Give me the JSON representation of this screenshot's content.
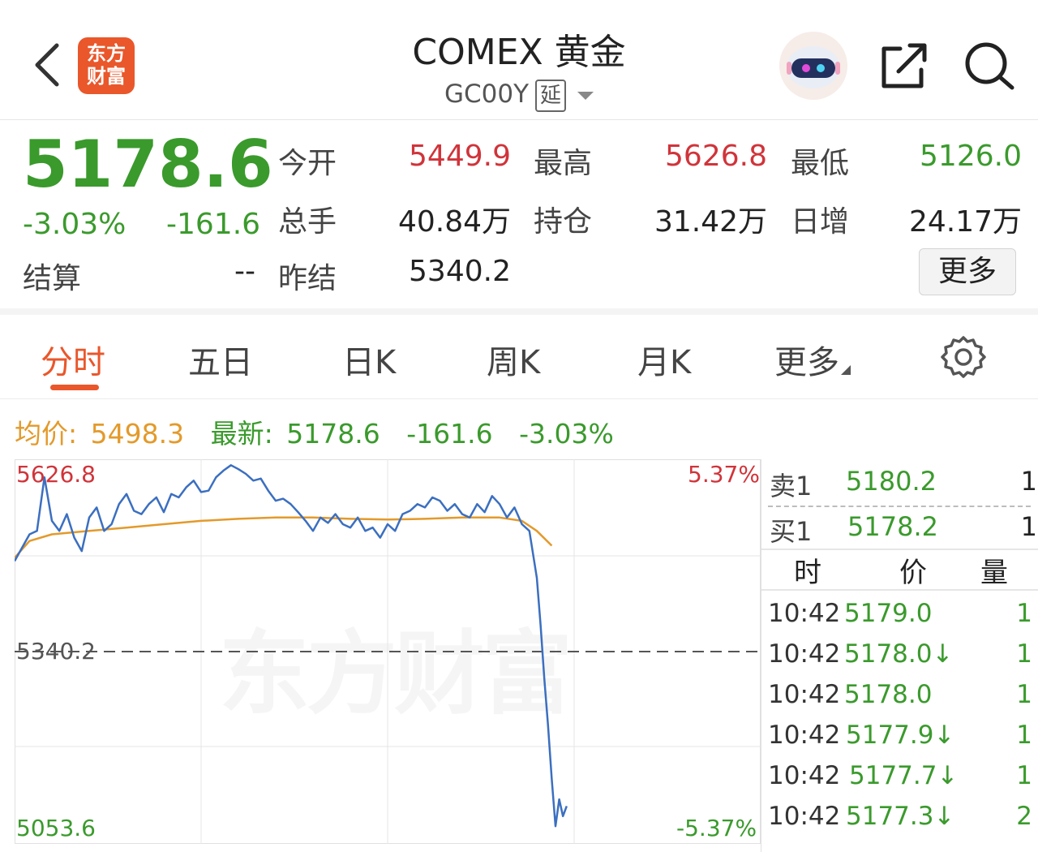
{
  "header": {
    "title": "COMEX 黄金",
    "code": "GC00Y",
    "delay_badge": "延",
    "logo_line1": "东方",
    "logo_line2": "财富"
  },
  "quote": {
    "last": "5178.6",
    "change_pct": "-3.03%",
    "change": "-161.6",
    "open_label": "今开",
    "open": "5449.9",
    "high_label": "最高",
    "high": "5626.8",
    "low_label": "最低",
    "low": "5126.0",
    "volume_label": "总手",
    "volume": "40.84万",
    "oi_label": "持仓",
    "oi": "31.42万",
    "daily_inc_label": "日增",
    "daily_inc": "24.17万",
    "settle_label": "结算",
    "settle": "--",
    "prev_settle_label": "昨结",
    "prev_settle": "5340.2",
    "more_label": "更多"
  },
  "tabs": [
    "分时",
    "五日",
    "日K",
    "周K",
    "月K",
    "更多"
  ],
  "legend": {
    "avg_label": "均价:",
    "avg": "5498.3",
    "latest_label": "最新:",
    "latest": "5178.6",
    "change": "-161.6",
    "change_pct": "-3.03%"
  },
  "chart_labels": {
    "top_price": "5626.8",
    "mid_price": "5340.2",
    "bottom_price": "5053.6",
    "top_pct": "5.37%",
    "bottom_pct": "-5.37%",
    "watermark": "东方财富"
  },
  "chart_data": {
    "type": "line",
    "x_range": [
      0,
      1
    ],
    "ylim": [
      5053.6,
      5626.8
    ],
    "reference": 5340.2,
    "series": [
      {
        "name": "price",
        "color": "#3b6fc0",
        "x": [
          0,
          0.02,
          0.03,
          0.04,
          0.05,
          0.06,
          0.07,
          0.08,
          0.09,
          0.1,
          0.11,
          0.12,
          0.13,
          0.14,
          0.15,
          0.16,
          0.17,
          0.18,
          0.19,
          0.2,
          0.21,
          0.22,
          0.23,
          0.24,
          0.25,
          0.26,
          0.27,
          0.28,
          0.29,
          0.3,
          0.31,
          0.32,
          0.33,
          0.34,
          0.35,
          0.36,
          0.37,
          0.38,
          0.39,
          0.4,
          0.41,
          0.42,
          0.43,
          0.44,
          0.45,
          0.46,
          0.47,
          0.48,
          0.49,
          0.5,
          0.51,
          0.52,
          0.53,
          0.54,
          0.55,
          0.56,
          0.57,
          0.58,
          0.59,
          0.6,
          0.61,
          0.62,
          0.63,
          0.64,
          0.65,
          0.66,
          0.67,
          0.68,
          0.69,
          0.7,
          0.705,
          0.71,
          0.715,
          0.72,
          0.725,
          0.73,
          0.735,
          0.74
        ],
        "values": [
          5475,
          5515,
          5520,
          5600,
          5535,
          5520,
          5545,
          5510,
          5490,
          5540,
          5555,
          5520,
          5530,
          5560,
          5575,
          5550,
          5545,
          5560,
          5570,
          5548,
          5575,
          5570,
          5585,
          5595,
          5578,
          5580,
          5600,
          5610,
          5618,
          5612,
          5605,
          5595,
          5598,
          5580,
          5565,
          5568,
          5560,
          5548,
          5535,
          5520,
          5540,
          5532,
          5545,
          5530,
          5525,
          5540,
          5520,
          5525,
          5510,
          5530,
          5520,
          5545,
          5550,
          5560,
          5555,
          5570,
          5565,
          5550,
          5560,
          5545,
          5540,
          5560,
          5548,
          5572,
          5560,
          5540,
          5555,
          5530,
          5520,
          5450,
          5380,
          5300,
          5230,
          5150,
          5080,
          5120,
          5095,
          5110
        ]
      },
      {
        "name": "avg",
        "color": "#e39a2b",
        "x": [
          0,
          0.02,
          0.05,
          0.1,
          0.15,
          0.2,
          0.25,
          0.3,
          0.35,
          0.4,
          0.45,
          0.5,
          0.55,
          0.6,
          0.65,
          0.68,
          0.7,
          0.72
        ],
        "values": [
          5480,
          5505,
          5515,
          5520,
          5525,
          5530,
          5535,
          5538,
          5540,
          5540,
          5538,
          5537,
          5538,
          5540,
          5540,
          5535,
          5520,
          5498
        ]
      }
    ]
  },
  "order_book": {
    "ask_label": "卖1",
    "ask": "5180.2",
    "ask_qty": "1",
    "bid_label": "买1",
    "bid": "5178.2",
    "bid_qty": "1"
  },
  "ticks": {
    "headers": [
      "时",
      "价",
      "量"
    ],
    "rows": [
      {
        "time": "10:42",
        "price": "5179.0",
        "qty": "1"
      },
      {
        "time": "10:42",
        "price": "5178.0↓",
        "qty": "1"
      },
      {
        "time": "10:42",
        "price": "5178.0",
        "qty": "1"
      },
      {
        "time": "10:42",
        "price": "5177.9↓",
        "qty": "1"
      },
      {
        "time": "10:42",
        "price": "5177.7↓",
        "qty": "1"
      },
      {
        "time": "10:42",
        "price": "5177.3↓",
        "qty": "2"
      }
    ]
  }
}
